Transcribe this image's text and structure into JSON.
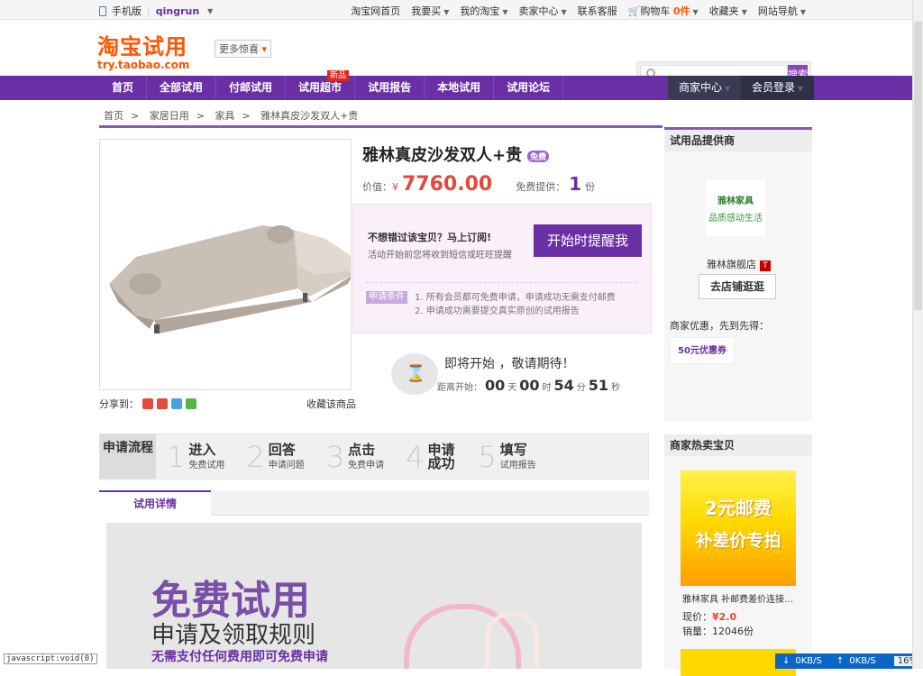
{
  "topbar": {
    "mobile": "手机版",
    "user": "qingrun",
    "links": [
      "淘宝网首页",
      "我要买",
      "我的淘宝",
      "卖家中心",
      "联系客服",
      "购物车",
      "收藏夹",
      "网站导航"
    ],
    "cart_count": "0件"
  },
  "header": {
    "logo_cn": "淘宝试用",
    "logo_en": "try.taobao.com",
    "more": "更多惊喜",
    "search_btn": "搜索"
  },
  "nav": {
    "items": [
      "首页",
      "全部试用",
      "付邮试用",
      "试用超市",
      "试用报告",
      "本地试用",
      "试用论坛"
    ],
    "new_badge": "新品",
    "seller": "商家中心",
    "member": "会员登录"
  },
  "breadcrumb": [
    "首页",
    "家居日用",
    "家具",
    "雅林真皮沙发双人+贵"
  ],
  "product": {
    "title": "雅林真皮沙发双人+贵",
    "tag": "免费",
    "price_label": "价值：",
    "currency": "¥",
    "price": "7760.00",
    "free_label": "免费提供：",
    "free_count": "1",
    "unit": "份"
  },
  "remind": {
    "t1": "不想错过该宝贝？马上订阅!",
    "t2": "活动开始前您将收到短信或旺旺提醒",
    "btn": "开始时提醒我",
    "cond_label": "申请条件",
    "cond1": "1. 所有会员都可免费申请，申请成功无需支付邮费",
    "cond2": "2. 申请成功需要提交真实原创的试用报告"
  },
  "countdown": {
    "heading": "即将开始 ，敬请期待！",
    "prefix": "距离开始：",
    "d": "00",
    "dl": "天",
    "h": "00",
    "hl": "时",
    "m": "54",
    "ml": "分",
    "s": "51",
    "sl": "秒"
  },
  "share": {
    "label": "分享到：",
    "fav": "收藏该商品"
  },
  "supplier": {
    "head": "试用品提供商",
    "logo_name": "雅林家具",
    "logo_slogan": "品质感动生活",
    "shop": "雅林旗舰店",
    "t": "T",
    "go": "去店铺逛逛",
    "merch": "商家优惠，先到先得：",
    "coupon": "50元优惠券"
  },
  "steps": {
    "first": "申请流程",
    "list": [
      {
        "n": "1",
        "big": "进入",
        "sm": "免费试用"
      },
      {
        "n": "2",
        "big": "回答",
        "sm": "申请问题"
      },
      {
        "n": "3",
        "big": "点击",
        "sm": "免费申请"
      },
      {
        "n": "4",
        "big": "申请成功",
        "sm": ""
      },
      {
        "n": "5",
        "big": "填写",
        "sm": "试用报告"
      }
    ]
  },
  "tab": "试用详情",
  "banner": {
    "h1": "免费试用",
    "h2": "申请及领取规则",
    "h3": "无需支付任何费用即可免费申请"
  },
  "hot": {
    "head": "商家热卖宝贝",
    "c1": "2元邮费",
    "c2": "补差价专拍",
    "title": "雅林家具 补邮费差价连接…",
    "now": "现价：",
    "price": "¥2.0",
    "sale": "销量：12046份"
  },
  "status": "javascript:void(0)",
  "net": {
    "down": "0KB/S",
    "up": "0KB/S",
    "pct": "16%"
  }
}
